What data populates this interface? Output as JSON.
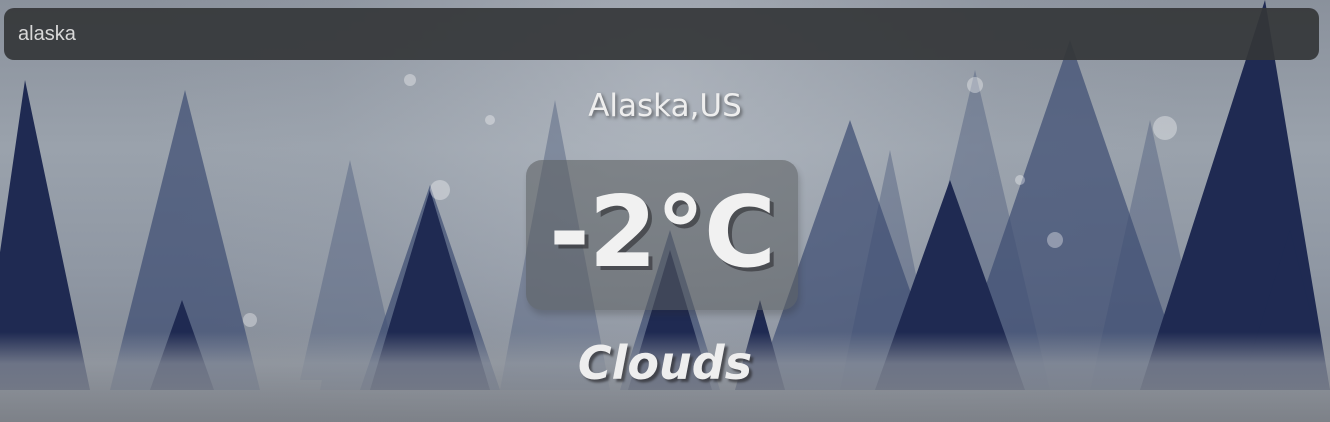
{
  "search": {
    "value": "alaska"
  },
  "weather": {
    "location": "Alaska,US",
    "temperature": "-2°C",
    "condition": "Clouds"
  },
  "colors": {
    "search_background": "#343638",
    "text": "#eeeeee",
    "temperature_box": "#5a5c5f",
    "tree_dark": "#1f2a52"
  }
}
